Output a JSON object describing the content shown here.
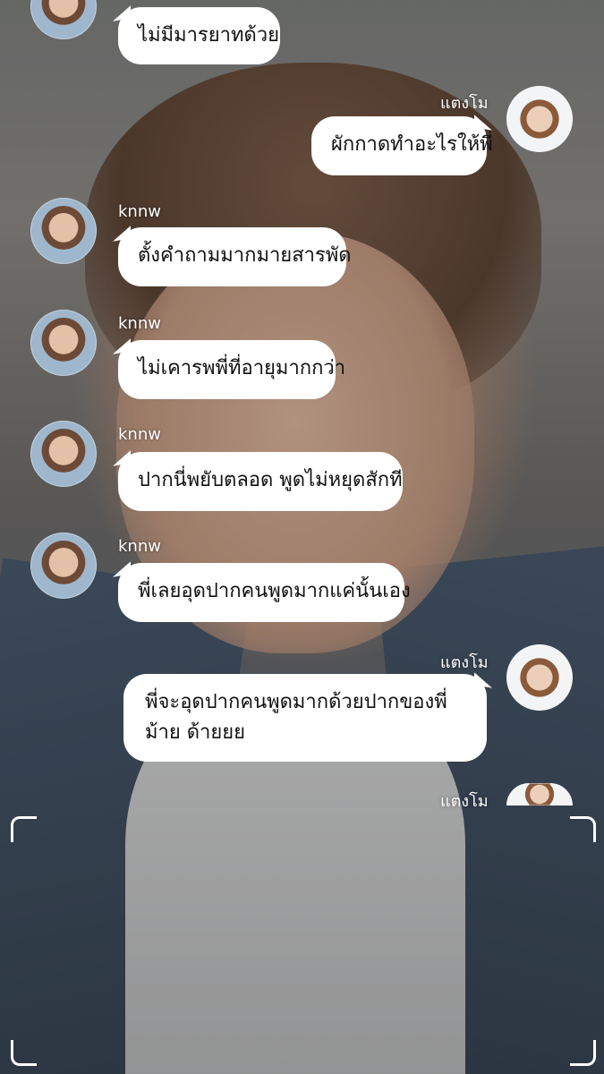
{
  "users": {
    "other": {
      "name": "knnw",
      "avatar_icon": "avatar-knnw"
    },
    "me": {
      "name": "แตงโม",
      "avatar_icon": "avatar-taengmo"
    }
  },
  "messages": [
    {
      "side": "left",
      "sender": "knnw",
      "text": "ไม่มีมารยาทด้วย",
      "show_name": false
    },
    {
      "side": "right",
      "sender": "แตงโม",
      "text": "ผักกาดทำอะไรให้พี่",
      "show_name": true
    },
    {
      "side": "left",
      "sender": "knnw",
      "text": "ตั้งคำถามมากมายสารพัด",
      "show_name": true
    },
    {
      "side": "left",
      "sender": "knnw",
      "text": "ไม่เคารพพี่ที่อายุมากกว่า",
      "show_name": true
    },
    {
      "side": "left",
      "sender": "knnw",
      "text": "ปากนี่พยับตลอด พูดไม่หยุดสักที",
      "show_name": true
    },
    {
      "side": "left",
      "sender": "knnw",
      "text": "พี่เลยอุดปากคนพูดมากแค่นั้นเอง",
      "show_name": true
    },
    {
      "side": "right",
      "sender": "แตงโม",
      "text": "พี่จะอุดปากคนพูดมากด้วยปากของพี่ม้าย ด้ายยย",
      "show_name": true
    },
    {
      "side": "right",
      "sender": "แตงโม",
      "text": "",
      "show_name": true
    }
  ]
}
